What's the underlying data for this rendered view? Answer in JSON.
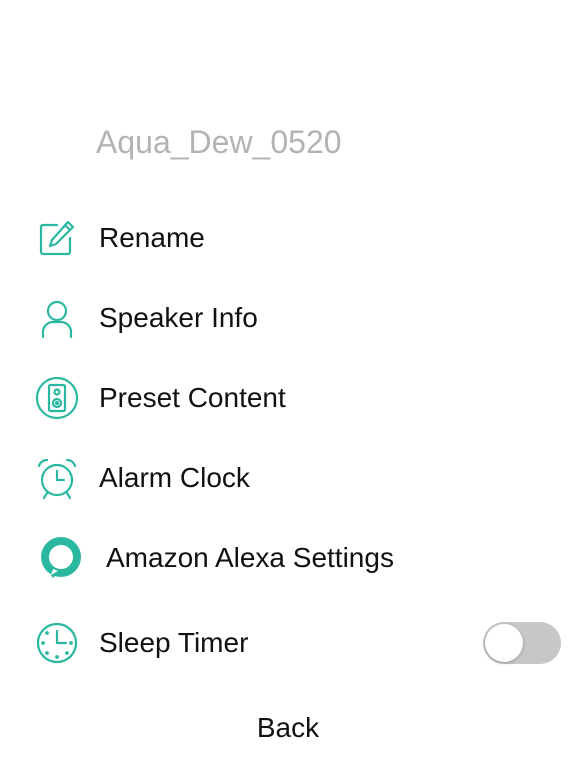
{
  "device": {
    "name": "Aqua_Dew_0520"
  },
  "theme": {
    "accent": "#2bb8a0",
    "toggle_off": "#c7c7c7",
    "device_name_color": "#b3b3b3"
  },
  "menu": {
    "items": [
      {
        "label": "Rename",
        "icon": "edit-icon"
      },
      {
        "label": "Speaker Info",
        "icon": "user-icon"
      },
      {
        "label": "Preset Content",
        "icon": "speaker-icon"
      },
      {
        "label": "Alarm Clock",
        "icon": "alarm-clock-icon"
      },
      {
        "label": "Amazon Alexa Settings",
        "icon": "alexa-icon"
      },
      {
        "label": "Sleep Timer",
        "icon": "timer-icon",
        "toggle": {
          "on": false
        }
      }
    ]
  },
  "footer": {
    "back_label": "Back"
  }
}
